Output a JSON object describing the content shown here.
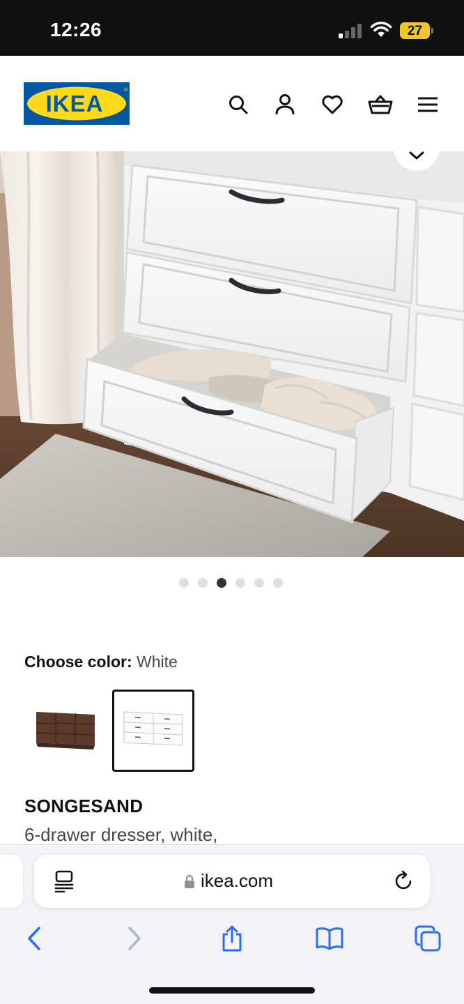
{
  "status_bar": {
    "time": "12:26",
    "battery_level": "27",
    "signal_bars_active": 1,
    "signal_bars_total": 4
  },
  "brand": {
    "logo_text": "IKEA",
    "brand_blue": "#0058a3",
    "brand_yellow": "#ffda1a"
  },
  "header": {
    "icons": [
      "search-icon",
      "account-icon",
      "favorites-heart-icon",
      "shopping-basket-icon",
      "menu-hamburger-icon"
    ]
  },
  "hero": {
    "collapse_icon": "chevron-down-icon"
  },
  "carousel": {
    "total_images": 6,
    "active_index": 2
  },
  "color_chooser": {
    "label": "Choose color:",
    "selected_value": "White",
    "options": [
      {
        "name": "Brown",
        "swatch_color": "#5b3a2b",
        "selected": false
      },
      {
        "name": "White",
        "swatch_color": "#f5f5f5",
        "selected": true
      }
    ]
  },
  "product": {
    "name": "SONGESAND",
    "description": "6-drawer dresser, white,"
  },
  "browser": {
    "url": "ikea.com",
    "lock_icon": "lock-icon",
    "reader_icon": "reader-mode-icon",
    "reload_icon": "reload-icon",
    "toolbar": [
      "back-icon",
      "forward-icon",
      "share-icon",
      "bookmarks-icon",
      "tabs-icon"
    ]
  }
}
